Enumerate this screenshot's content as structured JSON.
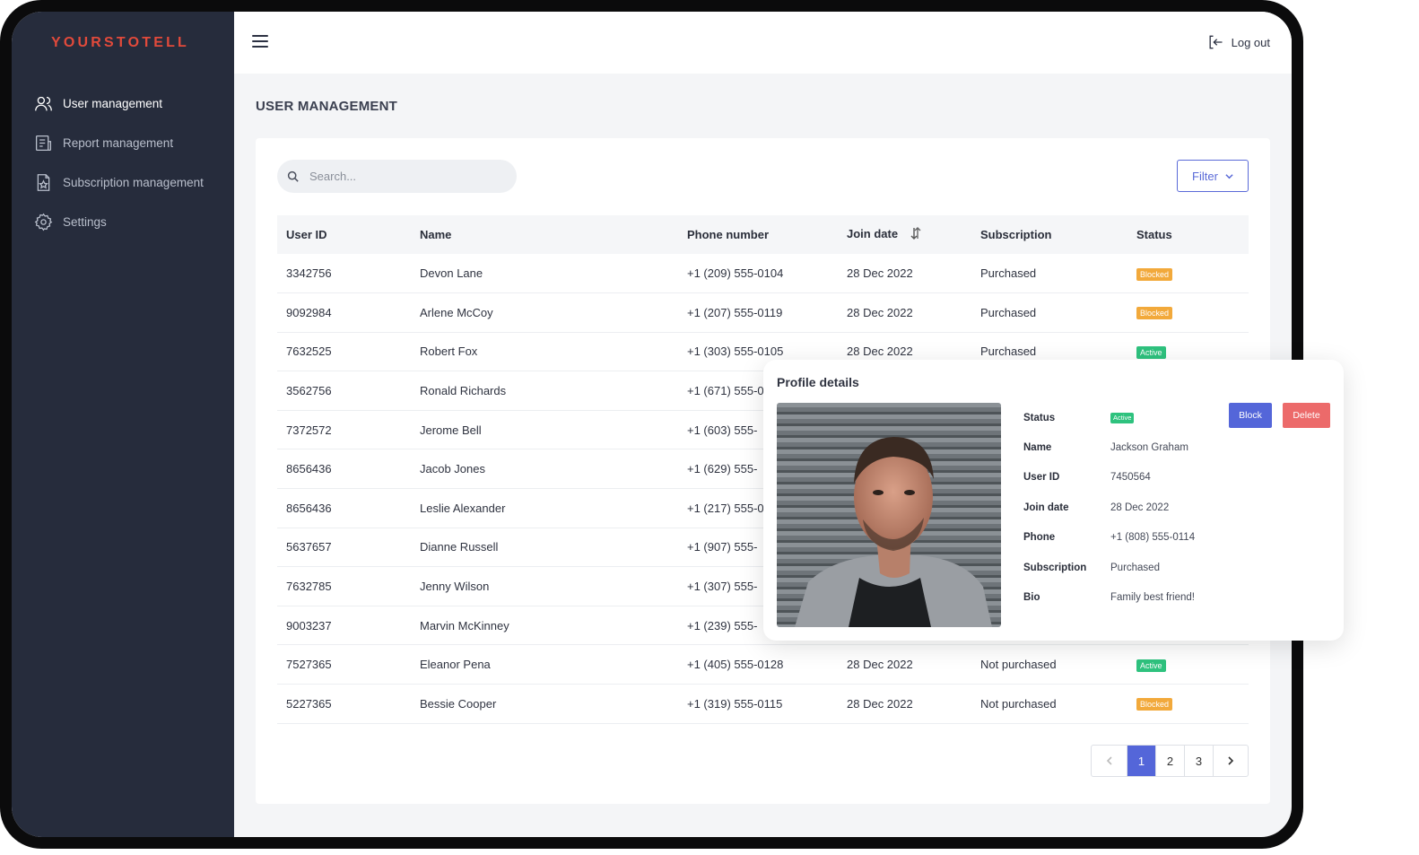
{
  "app": {
    "logo": "YOURSTOTELL"
  },
  "sidebar": {
    "items": [
      {
        "label": "User management",
        "icon": "users-icon",
        "active": true
      },
      {
        "label": "Report management",
        "icon": "report-icon",
        "active": false
      },
      {
        "label": "Subscription management",
        "icon": "subscription-icon",
        "active": false
      },
      {
        "label": "Settings",
        "icon": "gear-icon",
        "active": false
      }
    ]
  },
  "header": {
    "logout_label": "Log out"
  },
  "page": {
    "title": "USER MANAGEMENT"
  },
  "search": {
    "placeholder": "Search..."
  },
  "filter": {
    "label": "Filter"
  },
  "table": {
    "columns": [
      "User ID",
      "Name",
      "Phone number",
      "Join date",
      "Subscription",
      "Status"
    ],
    "rows": [
      {
        "id": "3342756",
        "name": "Devon Lane",
        "phone": "+1 (209) 555-0104",
        "date": "28 Dec 2022",
        "subscription": "Purchased",
        "status": "Blocked"
      },
      {
        "id": "9092984",
        "name": "Arlene McCoy",
        "phone": "+1 (207) 555-0119",
        "date": "28 Dec 2022",
        "subscription": "Purchased",
        "status": "Blocked"
      },
      {
        "id": "7632525",
        "name": "Robert Fox",
        "phone": "+1 (303) 555-0105",
        "date": "28 Dec 2022",
        "subscription": "Purchased",
        "status": "Active"
      },
      {
        "id": "3562756",
        "name": "Ronald Richards",
        "phone": "+1 (671) 555-0",
        "date": "",
        "subscription": "",
        "status": ""
      },
      {
        "id": "7372572",
        "name": "Jerome Bell",
        "phone": "+1 (603) 555-",
        "date": "",
        "subscription": "",
        "status": ""
      },
      {
        "id": "8656436",
        "name": "Jacob Jones",
        "phone": "+1 (629) 555-",
        "date": "",
        "subscription": "",
        "status": ""
      },
      {
        "id": "8656436",
        "name": "Leslie Alexander",
        "phone": "+1 (217) 555-0",
        "date": "",
        "subscription": "",
        "status": ""
      },
      {
        "id": "5637657",
        "name": "Dianne Russell",
        "phone": "+1 (907) 555-",
        "date": "",
        "subscription": "",
        "status": ""
      },
      {
        "id": "7632785",
        "name": "Jenny Wilson",
        "phone": "+1 (307) 555-",
        "date": "",
        "subscription": "",
        "status": ""
      },
      {
        "id": "9003237",
        "name": "Marvin McKinney",
        "phone": "+1 (239) 555-",
        "date": "",
        "subscription": "",
        "status": ""
      },
      {
        "id": "7527365",
        "name": "Eleanor Pena",
        "phone": "+1 (405) 555-0128",
        "date": "28 Dec 2022",
        "subscription": "Not purchased",
        "status": "Active"
      },
      {
        "id": "5227365",
        "name": "Bessie Cooper",
        "phone": "+1 (319) 555-0115",
        "date": "28 Dec 2022",
        "subscription": "Not purchased",
        "status": "Blocked"
      }
    ]
  },
  "pagination": {
    "pages": [
      "1",
      "2",
      "3"
    ],
    "current": "1"
  },
  "profile": {
    "title": "Profile details",
    "block_label": "Block",
    "delete_label": "Delete",
    "fields": [
      {
        "label": "Status",
        "value": "Active",
        "badge": true
      },
      {
        "label": "Name",
        "value": "Jackson Graham"
      },
      {
        "label": "User ID",
        "value": "7450564"
      },
      {
        "label": "Join date",
        "value": "28 Dec 2022"
      },
      {
        "label": "Phone",
        "value": "+1 (808) 555-0114"
      },
      {
        "label": "Subscription",
        "value": "Purchased"
      },
      {
        "label": "Bio",
        "value": "Family best friend!"
      }
    ]
  },
  "colors": {
    "accent": "#5466d9",
    "blocked": "#f2a93b",
    "active": "#2ec27e",
    "danger": "#ec6a6a",
    "sidebar": "#262c3c",
    "logo": "#e24a3b"
  }
}
